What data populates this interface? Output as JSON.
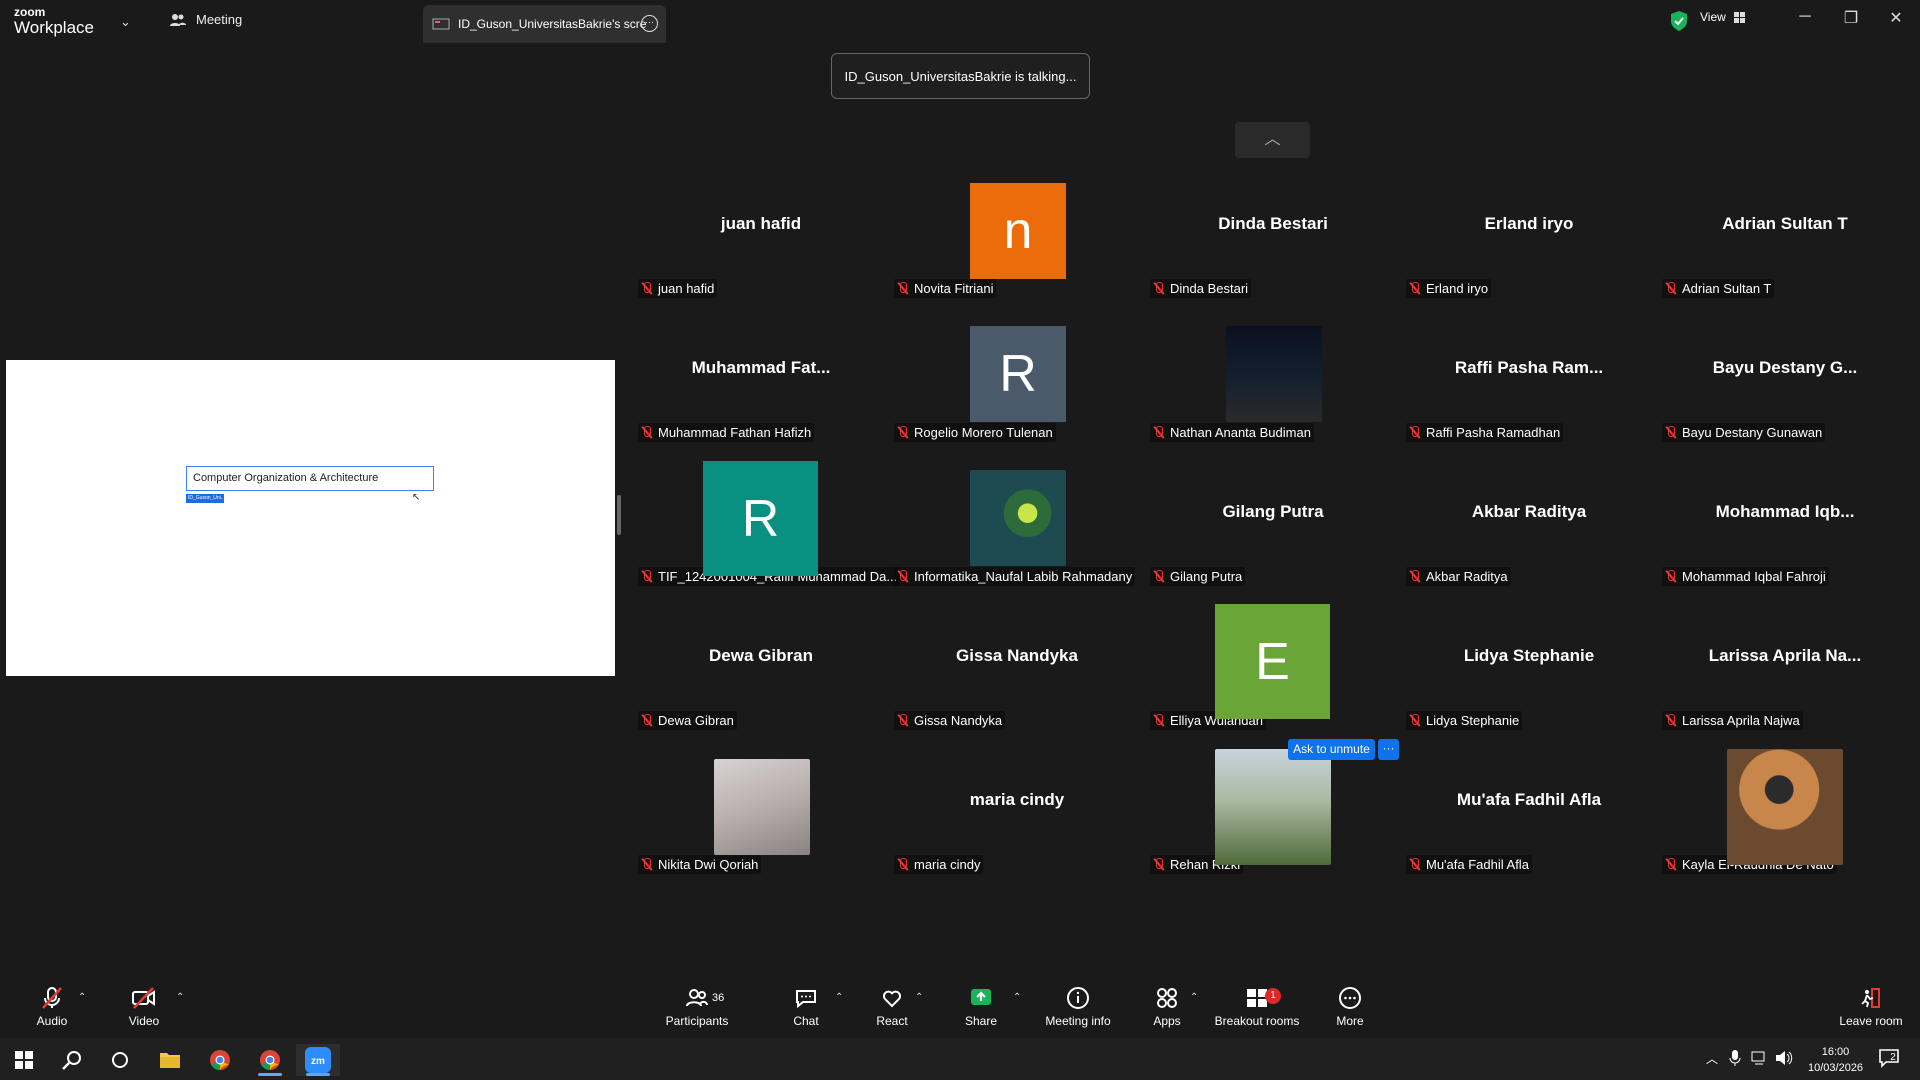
{
  "titlebar": {
    "brand_top": "zoom",
    "brand_bottom": "Workplace",
    "meeting_tab": "Meeting",
    "share_tab": "ID_Guson_UniversitasBakrie's scre",
    "view_label": "View"
  },
  "talking_banner": "ID_Guson_UniversitasBakrie is talking...",
  "shared_slide": {
    "title": "Computer Organization & Architecture",
    "tag": "ID_Guson_Uni..."
  },
  "participants": [
    {
      "display": "juan hafid",
      "label": "juan hafid"
    },
    {
      "display": "n",
      "label": "Novita Fitriani",
      "avatar_color": "#ec6c0b"
    },
    {
      "display": "Dinda Bestari",
      "label": "Dinda Bestari"
    },
    {
      "display": "Erland iryo",
      "label": "Erland iryo"
    },
    {
      "display": "Adrian Sultan T",
      "label": "Adrian Sultan T"
    },
    {
      "display": "Muhammad Fat...",
      "label": "Muhammad Fathan Hafizh"
    },
    {
      "display": "R",
      "label": "Rogelio Morero Tulenan",
      "avatar_color": "#4a5a6a"
    },
    {
      "display": "",
      "label": "Nathan Ananta Budiman"
    },
    {
      "display": "Raffi Pasha Ram...",
      "label": "Raffi Pasha Ramadhan"
    },
    {
      "display": "Bayu Destany G...",
      "label": "Bayu Destany Gunawan"
    },
    {
      "display": "R",
      "label": "TIF_1242001004_Rafiif Muhammad Da...",
      "avatar_color": "#0a9080"
    },
    {
      "display": "",
      "label": "Informatika_Naufal Labib Rahmadany"
    },
    {
      "display": "Gilang Putra",
      "label": "Gilang Putra"
    },
    {
      "display": "Akbar Raditya",
      "label": "Akbar Raditya"
    },
    {
      "display": "Mohammad Iqb...",
      "label": "Mohammad Iqbal Fahroji"
    },
    {
      "display": "Dewa Gibran",
      "label": "Dewa Gibran"
    },
    {
      "display": "Gissa Nandyka",
      "label": "Gissa Nandyka"
    },
    {
      "display": "E",
      "label": "Elliya Wulandari",
      "avatar_color": "#6aa637"
    },
    {
      "display": "Lidya Stephanie",
      "label": "Lidya Stephanie"
    },
    {
      "display": "Larissa Aprila Na...",
      "label": "Larissa Aprila Najwa"
    },
    {
      "display": "",
      "label": "Nikita Dwi Qoriah"
    },
    {
      "display": "maria cindy",
      "label": "maria cindy"
    },
    {
      "display": "",
      "label": "Rehan Rizki"
    },
    {
      "display": "Mu'afa Fadhil Afla",
      "label": "Mu'afa Fadhil Afla"
    },
    {
      "display": "",
      "label": "Kayla El-Raudhia De Nato"
    }
  ],
  "ask_unmute": "Ask to unmute",
  "ask_more": "···",
  "toolbar": {
    "audio": "Audio",
    "video": "Video",
    "participants": "Participants",
    "participants_count": "36",
    "chat": "Chat",
    "react": "React",
    "share": "Share",
    "meeting_info": "Meeting info",
    "apps": "Apps",
    "breakout_rooms": "Breakout rooms",
    "breakout_badge": "1",
    "more": "More",
    "leave_room": "Leave room"
  },
  "taskbar": {
    "time": "16:00",
    "date": "10/03/2026",
    "notifications": "2"
  },
  "colors": {
    "accent": "#0e72ed",
    "muted_red": "#e53935",
    "share_green": "#19b35a"
  }
}
